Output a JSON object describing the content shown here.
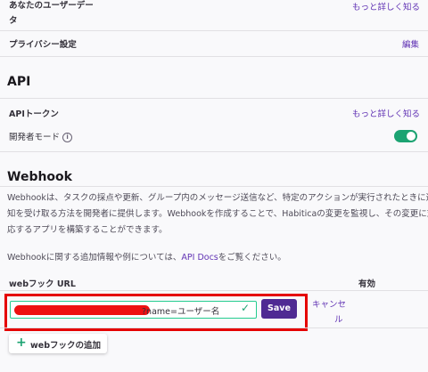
{
  "user_data": {
    "label_line1": "あなたのユーザーデー",
    "label_line2": "タ",
    "link": "もっと詳しく知る"
  },
  "privacy": {
    "label": "プライバシー設定",
    "link": "編集"
  },
  "api": {
    "title": "API",
    "token_label": "APIトークン",
    "token_link": "もっと詳しく知る",
    "dev_mode_label": "開発者モード",
    "info_icon": "i",
    "dev_mode_enabled": true
  },
  "webhook": {
    "title": "Webhook",
    "desc_line1": "Webhookは、タスクの採点や更新、グループ内のメッセージ送信など、特定のアクションが実行されたときに通",
    "desc_line2": "知を受け取る方法を開発者に提供します。Webhookを作成することで、Habiticaの変更を監視し、その変更に対",
    "desc_line3": "応するアプリを構築することができます。",
    "info_before": "Webhookに関する追加情報や例については、",
    "info_link": "API Docs",
    "info_after": "をご覧ください。",
    "col_url": "webフック URL",
    "col_enabled": "有効",
    "url_suffix": "?name=ユーザー名",
    "save_label": "Save",
    "cancel_line1": "キャンセ",
    "cancel_line2": "ル",
    "check_icon": "✓",
    "add_plus": "+",
    "add_label": "webフックの追加"
  },
  "colors": {
    "accent_purple": "#6133b4",
    "save_button": "#4f2a93",
    "toggle_on": "#1ca372",
    "input_border": "#24cc8f",
    "highlight_red": "#e50000"
  }
}
